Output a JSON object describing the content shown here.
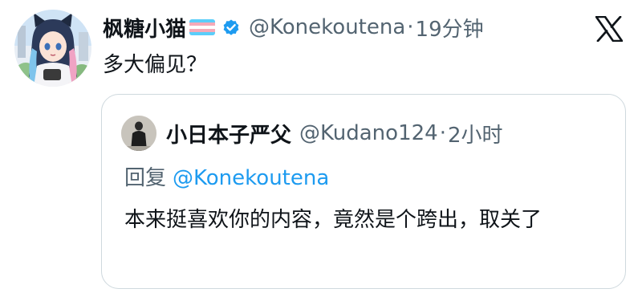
{
  "tweet": {
    "display_name": "枫糖小猫",
    "handle": "@Konekoutena",
    "separator": "·",
    "time": "19分钟",
    "text": "多大偏见？"
  },
  "quoted_tweet": {
    "display_name": "小日本子严父",
    "handle": "@Kudano124",
    "separator": "·",
    "time": "2小时",
    "reply_prefix": "回复",
    "reply_mention": "@Konekoutena",
    "text": "本来挺喜欢你的内容，竟然是个跨出，取关了"
  },
  "colors": {
    "text": "#0f1419",
    "secondary": "#536471",
    "link": "#1d9bf0",
    "verified": "#1d9bf0",
    "border": "#cfd9de"
  },
  "icons": {
    "flag": "transgender-flag-icon",
    "verified": "verified-badge-icon",
    "logo": "x-logo-icon"
  }
}
